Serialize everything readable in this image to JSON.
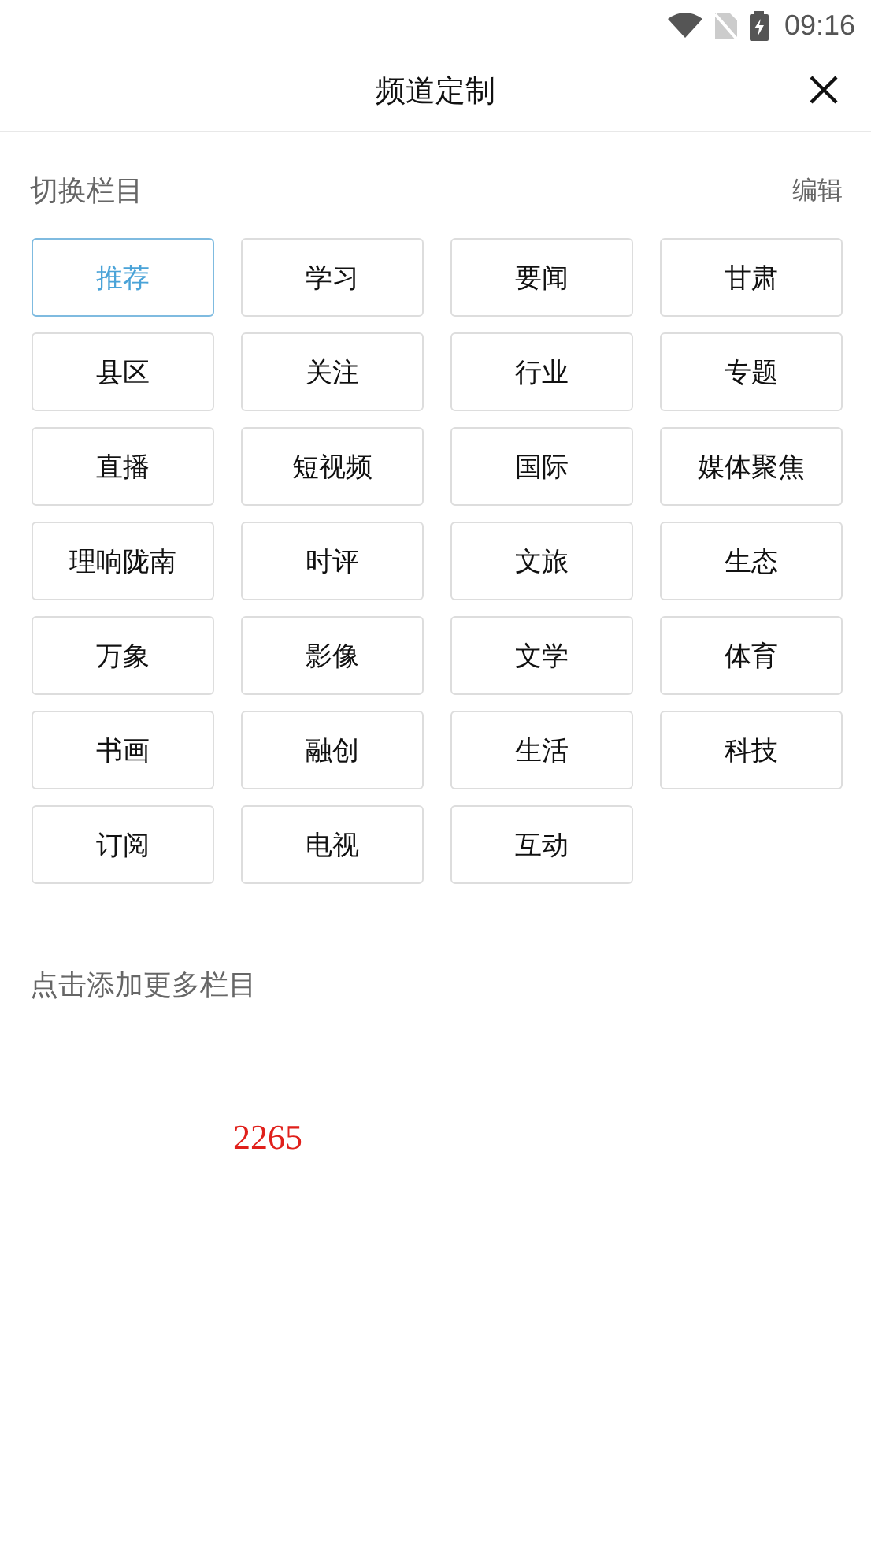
{
  "status_bar": {
    "time": "09:16"
  },
  "header": {
    "title": "频道定制"
  },
  "my_channels": {
    "title": "切换栏目",
    "edit": "编辑",
    "items": [
      {
        "label": "推荐",
        "selected": true
      },
      {
        "label": "学习",
        "selected": false
      },
      {
        "label": "要闻",
        "selected": false
      },
      {
        "label": "甘肃",
        "selected": false
      },
      {
        "label": "县区",
        "selected": false
      },
      {
        "label": "关注",
        "selected": false
      },
      {
        "label": "行业",
        "selected": false
      },
      {
        "label": "专题",
        "selected": false
      },
      {
        "label": "直播",
        "selected": false
      },
      {
        "label": "短视频",
        "selected": false
      },
      {
        "label": "国际",
        "selected": false
      },
      {
        "label": "媒体聚焦",
        "selected": false
      },
      {
        "label": "理响陇南",
        "selected": false
      },
      {
        "label": "时评",
        "selected": false
      },
      {
        "label": "文旅",
        "selected": false
      },
      {
        "label": "生态",
        "selected": false
      },
      {
        "label": "万象",
        "selected": false
      },
      {
        "label": "影像",
        "selected": false
      },
      {
        "label": "文学",
        "selected": false
      },
      {
        "label": "体育",
        "selected": false
      },
      {
        "label": "书画",
        "selected": false
      },
      {
        "label": "融创",
        "selected": false
      },
      {
        "label": "生活",
        "selected": false
      },
      {
        "label": "科技",
        "selected": false
      },
      {
        "label": "订阅",
        "selected": false
      },
      {
        "label": "电视",
        "selected": false
      },
      {
        "label": "互动",
        "selected": false
      }
    ]
  },
  "more_channels": {
    "title": "点击添加更多栏目"
  },
  "debug_number": "2265"
}
